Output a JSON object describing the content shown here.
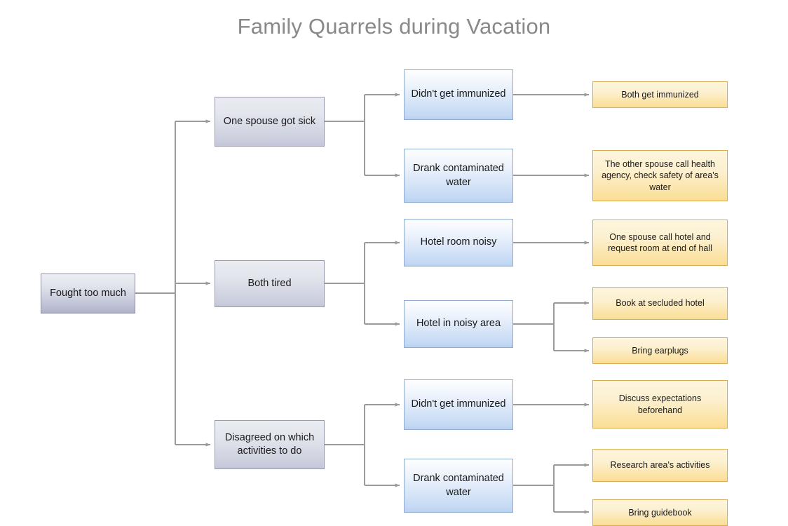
{
  "title": "Family Quarrels during Vacation",
  "colors": {
    "title_text": "#898989",
    "connector": "#9a9a9a",
    "gray_node_fill_top": "#eceef3",
    "gray_node_fill_bottom": "#b9bdd2",
    "gray_node_border": "#9a9cae",
    "blue_node_fill_top": "#fdfeff",
    "blue_node_fill_bottom": "#c4d9f4",
    "blue_node_border": "#8fabd0",
    "yellow_node_fill_top": "#fdf5dd",
    "yellow_node_fill_bottom": "#fbdf98",
    "yellow_node_border": "#d8ac52",
    "node_text": "#1a1a1a",
    "background": "#ffffff"
  },
  "root": {
    "label": "Fought too much"
  },
  "causes": [
    {
      "label": "One spouse got sick",
      "subcauses": [
        {
          "label": "Didn't get immunized",
          "solutions": [
            "Both get immunized"
          ]
        },
        {
          "label": "Drank contaminated water",
          "solutions": [
            "The other spouse call health agency, check safety of area's water"
          ]
        }
      ]
    },
    {
      "label": "Both tired",
      "subcauses": [
        {
          "label": "Hotel room noisy",
          "solutions": [
            "One spouse call hotel and request room at end of hall"
          ]
        },
        {
          "label": "Hotel in noisy area",
          "solutions": [
            "Book at secluded hotel",
            "Bring earplugs"
          ]
        }
      ]
    },
    {
      "label": "Disagreed on which activities to do",
      "subcauses": [
        {
          "label": "Didn't get immunized",
          "solutions": [
            "Discuss expectations beforehand"
          ]
        },
        {
          "label": "Drank contaminated water",
          "solutions": [
            "Research area's activities",
            "Bring guidebook"
          ]
        }
      ]
    }
  ]
}
